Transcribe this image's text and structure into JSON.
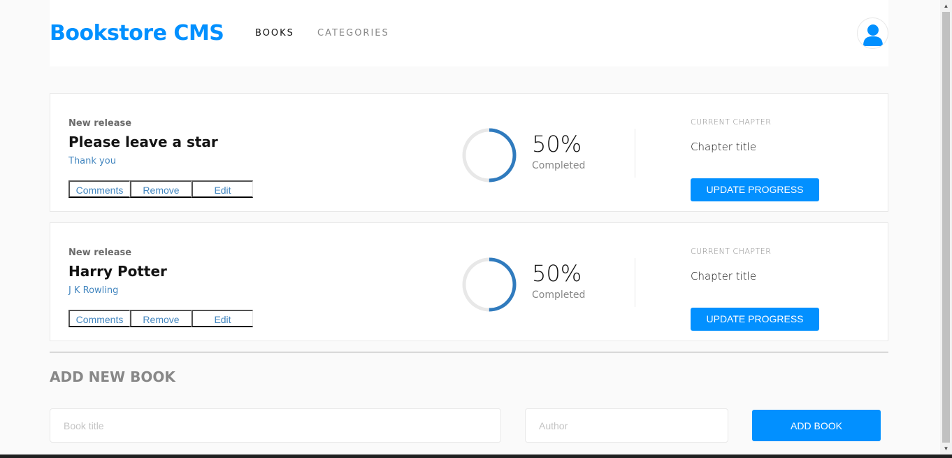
{
  "header": {
    "logo": "Bookstore CMS",
    "nav": {
      "books": "BOOKS",
      "categories": "CATEGORIES"
    }
  },
  "colors": {
    "primary": "#0290ff",
    "link": "#4386bf",
    "progress": "#307bbe",
    "track": "#e8e8e8"
  },
  "books": [
    {
      "genre": "New release",
      "title": "Please leave a star",
      "author": "Thank you",
      "actions": {
        "comments": "Comments",
        "remove": "Remove",
        "edit": "Edit"
      },
      "progress_percent": 50,
      "percent_label": "50%",
      "completed_label": "Completed",
      "chapter_label": "CURRENT CHAPTER",
      "chapter_title": "Chapter title",
      "update_label": "UPDATE PROGRESS"
    },
    {
      "genre": "New release",
      "title": "Harry Potter",
      "author": "J K Rowling",
      "actions": {
        "comments": "Comments",
        "remove": "Remove",
        "edit": "Edit"
      },
      "progress_percent": 50,
      "percent_label": "50%",
      "completed_label": "Completed",
      "chapter_label": "CURRENT CHAPTER",
      "chapter_title": "Chapter title",
      "update_label": "UPDATE PROGRESS"
    }
  ],
  "form": {
    "title": "ADD NEW BOOK",
    "title_placeholder": "Book title",
    "author_placeholder": "Author",
    "submit_label": "ADD BOOK"
  },
  "icons": {
    "avatar": "user-icon",
    "scroll_up": "scroll-up-arrow-icon",
    "scroll_down": "scroll-down-arrow-icon"
  }
}
